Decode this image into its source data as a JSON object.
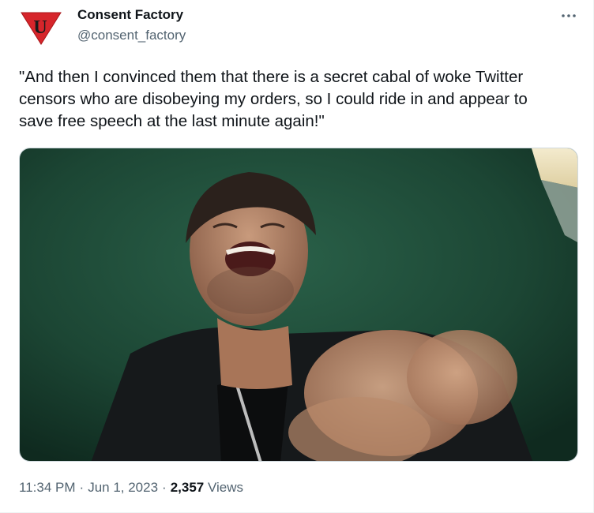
{
  "author": {
    "display_name": "Consent Factory",
    "handle": "@consent_factory",
    "avatar_letter": "U",
    "avatar_color": "#d6252b"
  },
  "menu": {
    "more_glyph": "···"
  },
  "tweet": {
    "text": "\"And then I convinced them that there is a secret cabal of woke Twitter\ncensors who are disobeying my orders, so I could ride in and appear to\nsave free speech at the last minute again!\""
  },
  "meta": {
    "time": "11:34 PM",
    "separator": "·",
    "date": "Jun 1, 2023",
    "views_count": "2,357",
    "views_label": "Views"
  },
  "colors": {
    "text_primary": "#0f1419",
    "text_secondary": "#536471",
    "border": "#cfd9de",
    "media_background": "#1e4a38"
  }
}
